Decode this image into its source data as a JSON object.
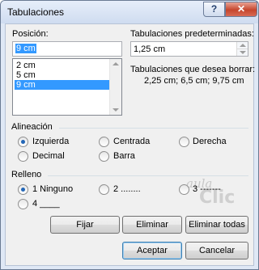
{
  "window": {
    "title": "Tabulaciones",
    "help_label": "?",
    "close_label": "✕"
  },
  "posicion": {
    "label": "Posición:",
    "value": "9 cm",
    "items": [
      "2 cm",
      "5 cm",
      "9 cm"
    ],
    "selected_index": 2
  },
  "predeterminadas": {
    "label": "Tabulaciones predeterminadas:",
    "value": "1,25 cm"
  },
  "borrar": {
    "label": "Tabulaciones que desea borrar:",
    "value": "2,25 cm; 6,5 cm; 9,75 cm"
  },
  "alineacion": {
    "label": "Alineación",
    "options": [
      "Izquierda",
      "Centrada",
      "Derecha",
      "Decimal",
      "Barra"
    ],
    "selected": "Izquierda"
  },
  "relleno": {
    "label": "Relleno",
    "options": [
      "1 Ninguno",
      "2 ........",
      "3 -------",
      "4 ____"
    ],
    "selected": "1 Ninguno"
  },
  "buttons": {
    "fijar": "Fijar",
    "eliminar": "Eliminar",
    "eliminar_todas": "Eliminar todas",
    "aceptar": "Aceptar",
    "cancelar": "Cancelar"
  },
  "watermark": {
    "line1": "aula",
    "line2": "Clic"
  },
  "colors": {
    "selection": "#3399ff",
    "radio_dot": "#2467b7",
    "close_button": "#c6462d"
  }
}
